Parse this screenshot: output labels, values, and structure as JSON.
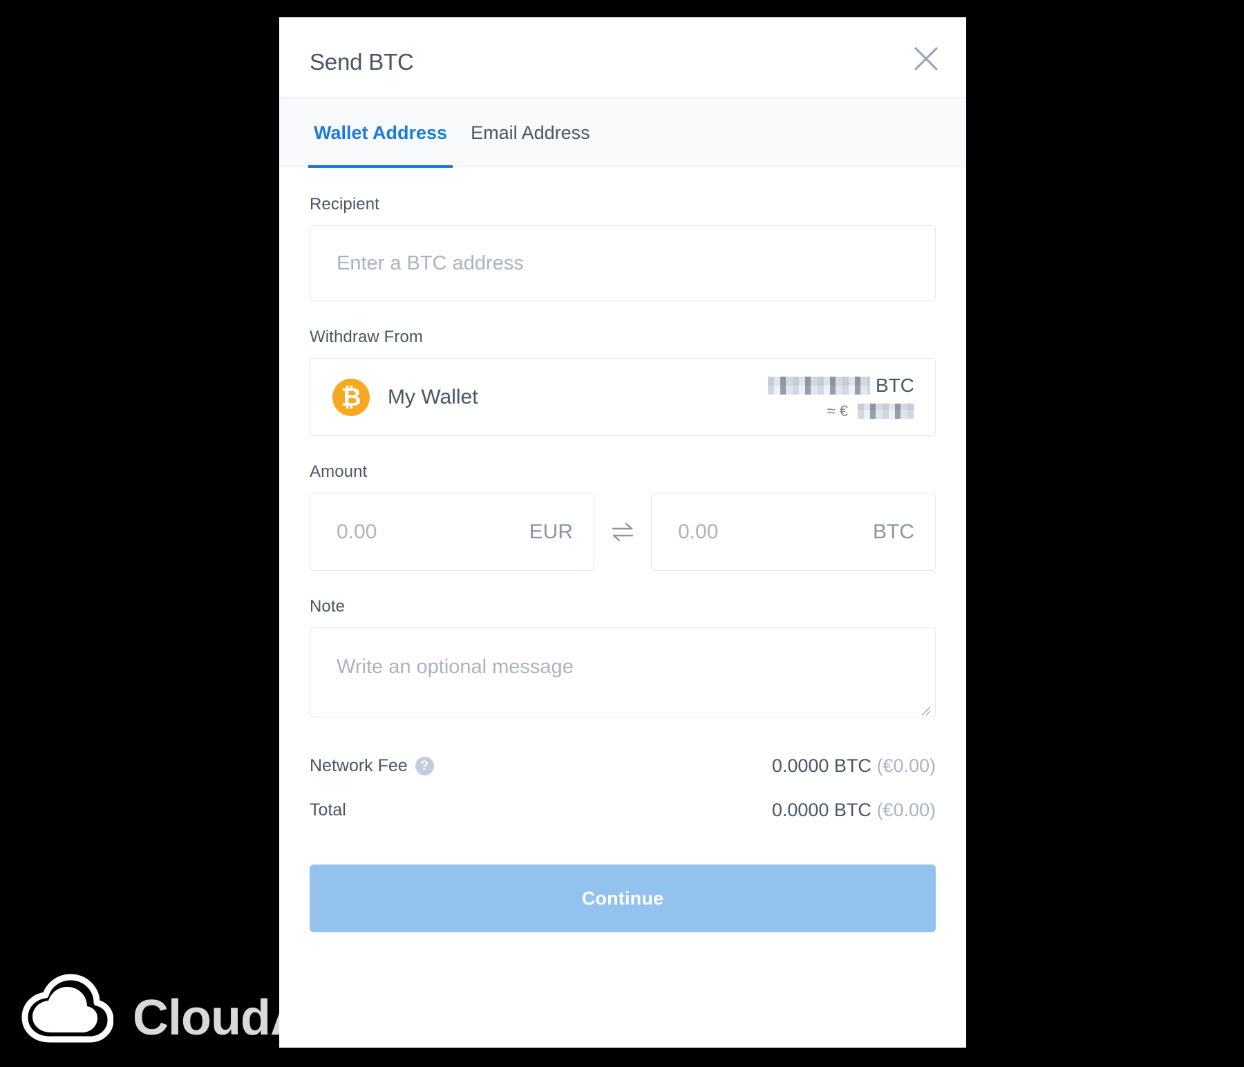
{
  "modal": {
    "title": "Send BTC",
    "close_icon": "close-icon",
    "tabs": [
      {
        "label": "Wallet Address",
        "active": true
      },
      {
        "label": "Email Address",
        "active": false
      }
    ],
    "recipient": {
      "label": "Recipient",
      "placeholder": "Enter a BTC address",
      "value": ""
    },
    "withdraw_from": {
      "label": "Withdraw From",
      "coin_symbol": "₿",
      "coin_color": "#f8a922",
      "wallet_name": "My Wallet",
      "balance_redacted": true,
      "balance_unit": "BTC",
      "fiat_approx_prefix": "≈ €",
      "fiat_redacted": true
    },
    "amount": {
      "label": "Amount",
      "fiat": {
        "value": "0.00",
        "currency": "EUR"
      },
      "crypto": {
        "value": "0.00",
        "currency": "BTC"
      },
      "swap_icon": "swap-arrows-icon"
    },
    "note": {
      "label": "Note",
      "placeholder": "Write an optional message",
      "value": ""
    },
    "summary": {
      "network_fee": {
        "label": "Network Fee",
        "help_icon": "help-icon",
        "help_glyph": "?",
        "btc": "0.0000 BTC",
        "fiat": "(€0.00)"
      },
      "total": {
        "label": "Total",
        "btc": "0.0000 BTC",
        "fiat": "(€0.00)"
      }
    },
    "continue_button": {
      "label": "Continue",
      "color": "#94c2ef"
    }
  },
  "watermark": {
    "text": "CloudApp",
    "icon": "cloud-icon"
  },
  "colors": {
    "accent_blue": "#1b7bdc",
    "text_dark": "#4a5665",
    "text_muted": "#aab4c0",
    "border": "#e3e8ee",
    "bitcoin_orange": "#f8a922",
    "button_blue": "#94c2ef",
    "backdrop": "#000000"
  }
}
